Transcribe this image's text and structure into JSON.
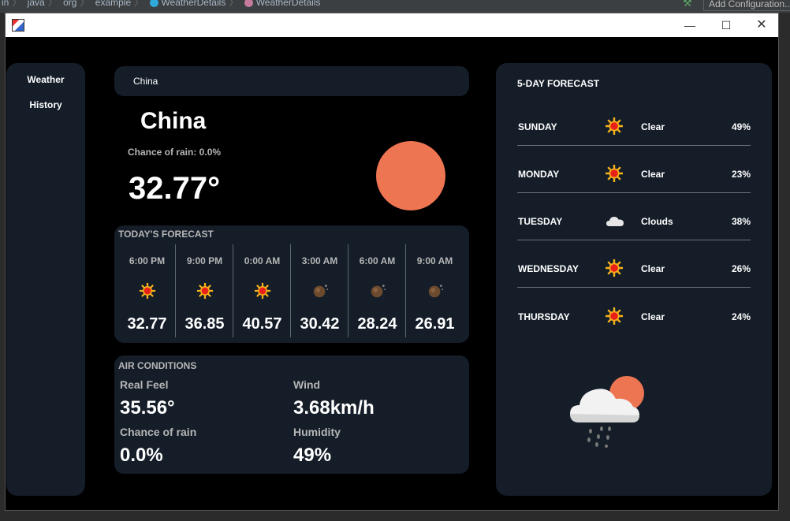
{
  "ide": {
    "breadcrumbs": [
      "in",
      "java",
      "org",
      "example",
      "WeatherDetails",
      "WeatherDetails"
    ],
    "add_config_label": "Add Configuration..."
  },
  "window": {
    "title": ""
  },
  "sidebar": {
    "items": [
      {
        "label": "Weather"
      },
      {
        "label": "History"
      }
    ]
  },
  "search": {
    "value": "China"
  },
  "current": {
    "city": "China",
    "chance_of_rain": "Chance of rain: 0.0%",
    "temperature": "32.77°"
  },
  "today": {
    "title": "TODAY'S FORECAST",
    "hours": [
      {
        "time": "6:00 PM",
        "icon": "sun-icon",
        "temp": "32.77"
      },
      {
        "time": "9:00 PM",
        "icon": "sun-icon",
        "temp": "36.85"
      },
      {
        "time": "0:00 AM",
        "icon": "sun-icon",
        "temp": "40.57"
      },
      {
        "time": "3:00 AM",
        "icon": "moon-icon",
        "temp": "30.42"
      },
      {
        "time": "6:00 AM",
        "icon": "moon-icon",
        "temp": "28.24"
      },
      {
        "time": "9:00 AM",
        "icon": "moon-icon",
        "temp": "26.91"
      }
    ]
  },
  "air": {
    "title": "AIR CONDITIONS",
    "real_feel_label": "Real Feel",
    "real_feel": "35.56°",
    "wind_label": "Wind",
    "wind": "3.68km/h",
    "rain_label": "Chance of rain",
    "rain": "0.0%",
    "humidity_label": "Humidity",
    "humidity": "49%"
  },
  "five_day": {
    "title": "5-DAY FORECAST",
    "days": [
      {
        "day": "SUNDAY",
        "icon": "sun-icon",
        "condition": "Clear",
        "percent": "49%"
      },
      {
        "day": "MONDAY",
        "icon": "sun-icon",
        "condition": "Clear",
        "percent": "23%"
      },
      {
        "day": "TUESDAY",
        "icon": "cloud-icon",
        "condition": "Clouds",
        "percent": "38%"
      },
      {
        "day": "WEDNESDAY",
        "icon": "sun-icon",
        "condition": "Clear",
        "percent": "26%"
      },
      {
        "day": "THURSDAY",
        "icon": "sun-icon",
        "condition": "Clear",
        "percent": "24%"
      }
    ]
  },
  "colors": {
    "panel": "#141d28",
    "background": "#000000",
    "sun_disc": "#ee7552",
    "sun_icon_core": "#e8201a",
    "sun_icon_rays": "#f6b21c"
  }
}
